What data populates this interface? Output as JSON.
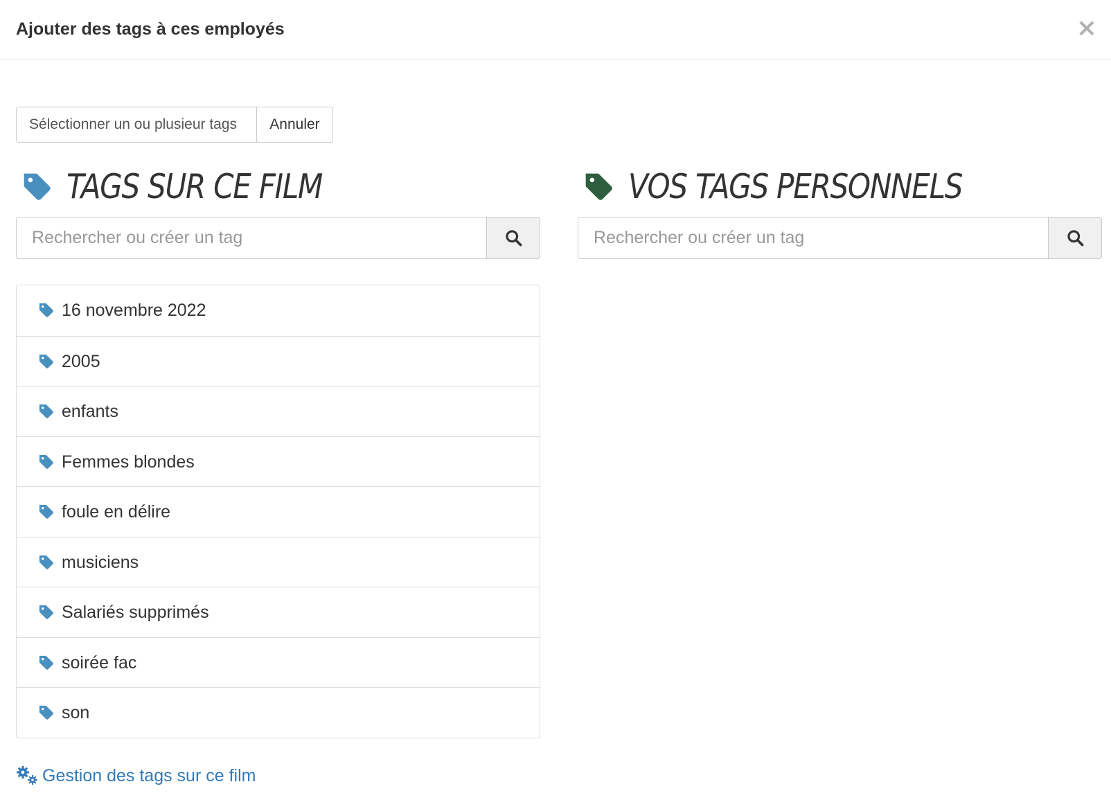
{
  "modal": {
    "title": "Ajouter des tags à ces employés",
    "close_label": "×"
  },
  "selector": {
    "placeholder": "Sélectionner un ou plusieur tags",
    "cancel_label": "Annuler"
  },
  "film_tags": {
    "heading": "TAGS SUR CE FILM",
    "icon": "tag-icon",
    "icon_color": "#4a90bf",
    "search_placeholder": "Rechercher ou créer un tag",
    "items": [
      {
        "label": "16 novembre 2022"
      },
      {
        "label": "2005"
      },
      {
        "label": "enfants"
      },
      {
        "label": "Femmes blondes"
      },
      {
        "label": "foule en délire"
      },
      {
        "label": "musiciens"
      },
      {
        "label": "Salariés supprimés"
      },
      {
        "label": "soirée fac"
      },
      {
        "label": "son"
      }
    ]
  },
  "personal_tags": {
    "heading": "VOS TAGS PERSONNELS",
    "icon": "tag-icon",
    "icon_color": "#2e5e3e",
    "search_placeholder": "Rechercher ou créer un tag"
  },
  "footer": {
    "manage_link": "Gestion des tags sur ce film",
    "icon": "cogs-icon",
    "link_color": "#337ab7"
  }
}
